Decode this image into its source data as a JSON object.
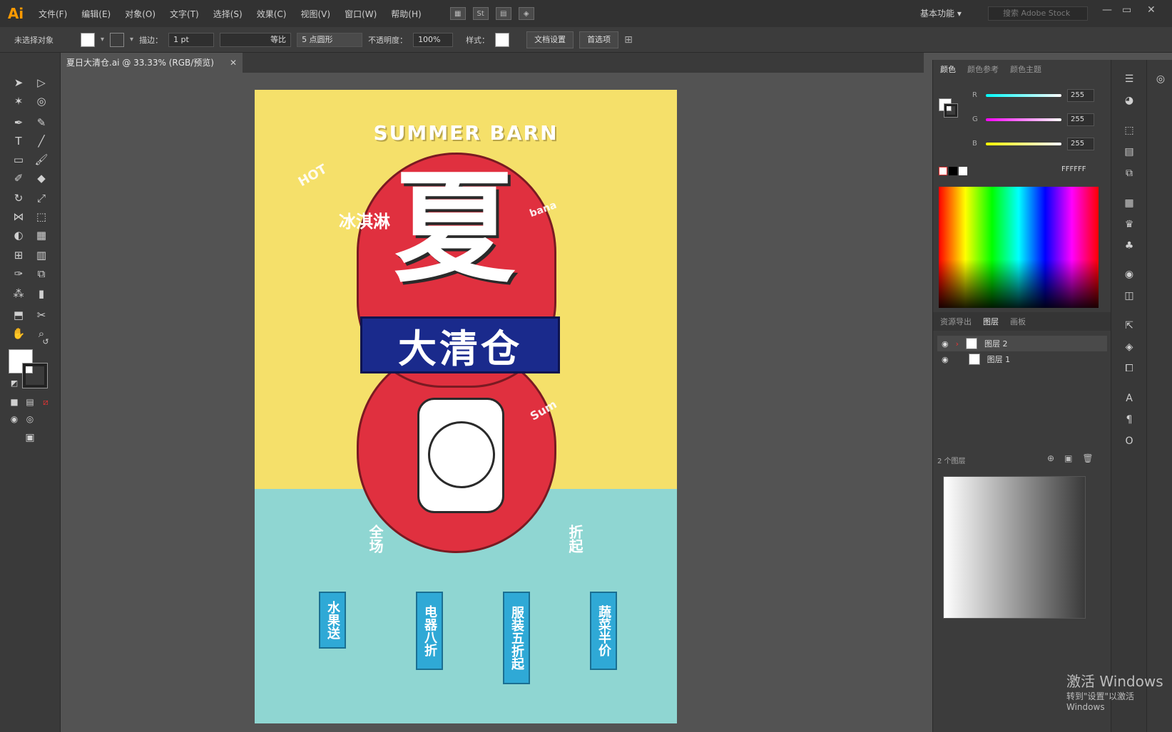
{
  "app": {
    "logo": "Ai"
  },
  "menu": [
    "文件(F)",
    "编辑(E)",
    "对象(O)",
    "文字(T)",
    "选择(S)",
    "效果(C)",
    "视图(V)",
    "窗口(W)",
    "帮助(H)"
  ],
  "menu_extra": {
    "st": "St"
  },
  "workspace": {
    "label": "基本功能"
  },
  "search": {
    "placeholder": "搜索 Adobe Stock"
  },
  "controlbar": {
    "selection_label": "未选择对象",
    "stroke_label": "描边：",
    "stroke_value": "1 pt",
    "stroke_style": "等比",
    "brush": "5 点圆形",
    "opacity_label": "不透明度：",
    "opacity_value": "100%",
    "style_label": "样式：",
    "doc_setup": "文档设置",
    "preferences": "首选项"
  },
  "document_tab": {
    "title": "夏日大清仓.ai @ 33.33% (RGB/预览)"
  },
  "poster": {
    "title": "SUMMER BARN",
    "big_char": "夏",
    "banner": "大清仓",
    "ice_cream": "冰淇淋",
    "left_side": "全场",
    "right_side": "折起",
    "hot": "HOT",
    "banana": "bana",
    "summer": "Sum",
    "categories": [
      "水果送",
      "电器八折",
      "服装五折起",
      "蔬菜半价"
    ]
  },
  "color_panel": {
    "tabs": [
      "颜色",
      "颜色参考",
      "颜色主题"
    ],
    "r": "255",
    "g": "255",
    "b": "255",
    "r_label": "R",
    "g_label": "G",
    "b_label": "B",
    "hex": "FFFFFF"
  },
  "layers_panel": {
    "tabs": [
      "资源导出",
      "图层",
      "画板"
    ],
    "layers": [
      "图层 2",
      "图层 1"
    ],
    "count": "2 个图层"
  },
  "watermark": {
    "line1": "激活 Windows",
    "line2": "转到\"设置\"以激活 Windows"
  }
}
